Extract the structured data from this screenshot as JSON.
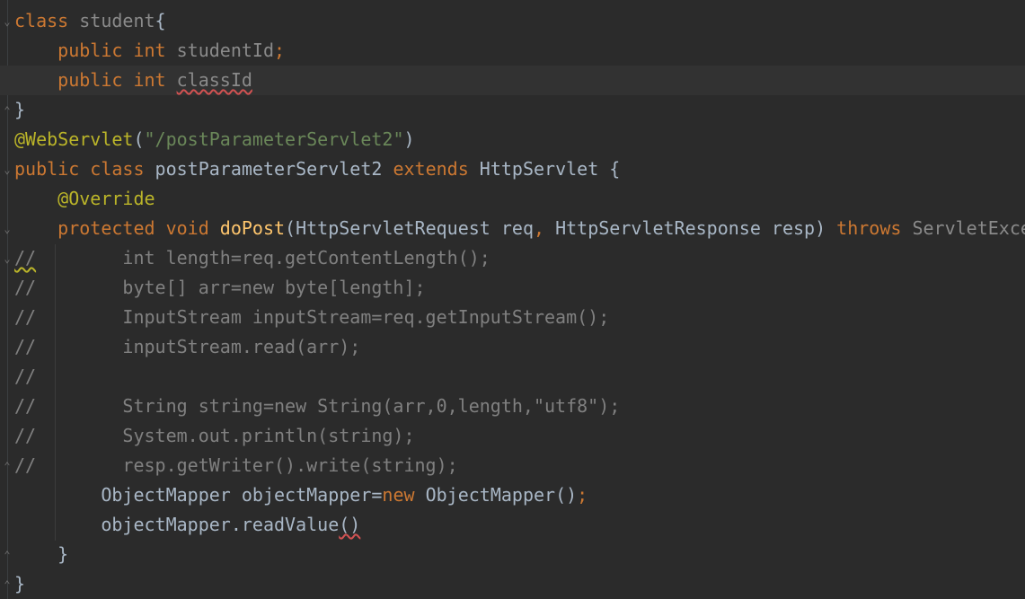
{
  "lines": [
    {
      "indent": "",
      "parts": [
        [
          "kw",
          "class "
        ],
        [
          "gray",
          "student"
        ],
        [
          "plain",
          "{"
        ]
      ],
      "fold": "▽"
    },
    {
      "indent": "    ",
      "parts": [
        [
          "kw",
          "public int "
        ],
        [
          "gray",
          "studentId"
        ],
        [
          "kw",
          ";"
        ]
      ]
    },
    {
      "indent": "    ",
      "parts": [
        [
          "kw",
          "public int "
        ],
        [
          "gray",
          "classId"
        ]
      ],
      "current": true,
      "error": "classId"
    },
    {
      "indent": "",
      "parts": [
        [
          "plain",
          "}"
        ]
      ],
      "fold": "△"
    },
    {
      "indent": "",
      "parts": [
        [
          "ann",
          "@WebServlet"
        ],
        [
          "plain",
          "("
        ],
        [
          "str",
          "\"/postParameterServlet2\""
        ],
        [
          "plain",
          ")"
        ]
      ]
    },
    {
      "indent": "",
      "parts": [
        [
          "kw",
          "public class "
        ],
        [
          "plain",
          "postParameterServlet2 "
        ],
        [
          "kw",
          "extends "
        ],
        [
          "plain",
          "HttpServlet {"
        ]
      ],
      "fold": "▽"
    },
    {
      "indent": "    ",
      "parts": [
        [
          "ann",
          "@Override"
        ]
      ]
    },
    {
      "indent": "    ",
      "parts": [
        [
          "kw",
          "protected void "
        ],
        [
          "fn",
          "doPost"
        ],
        [
          "plain",
          "(HttpServletRequest req"
        ],
        [
          "kw",
          ", "
        ],
        [
          "plain",
          "HttpServletResponse resp) "
        ],
        [
          "kw",
          "throws "
        ],
        [
          "gray",
          "ServletExce"
        ]
      ],
      "fold": "▽"
    },
    {
      "indent": "",
      "parts": [
        [
          "cm",
          "//        int length=req.getContentLength();"
        ]
      ],
      "fold": "▽",
      "warn": "//"
    },
    {
      "indent": "",
      "parts": [
        [
          "cm",
          "//        byte[] arr=new byte[length];"
        ]
      ]
    },
    {
      "indent": "",
      "parts": [
        [
          "cm",
          "//        InputStream inputStream=req.getInputStream();"
        ]
      ]
    },
    {
      "indent": "",
      "parts": [
        [
          "cm",
          "//        inputStream.read(arr);"
        ]
      ]
    },
    {
      "indent": "",
      "parts": [
        [
          "cm",
          "//"
        ]
      ]
    },
    {
      "indent": "",
      "parts": [
        [
          "cm",
          "//        String string=new String(arr,0,length,\"utf8\");"
        ]
      ]
    },
    {
      "indent": "",
      "parts": [
        [
          "cm",
          "//        System.out.println(string);"
        ]
      ]
    },
    {
      "indent": "",
      "parts": [
        [
          "cm",
          "//        resp.getWriter().write(string);"
        ]
      ],
      "fold": "△"
    },
    {
      "indent": "        ",
      "parts": [
        [
          "plain",
          "ObjectMapper objectMapper="
        ],
        [
          "kw",
          "new "
        ],
        [
          "plain",
          "ObjectMapper()"
        ],
        [
          "kw",
          ";"
        ]
      ]
    },
    {
      "indent": "        ",
      "parts": [
        [
          "plain",
          "objectMapper.readValue"
        ],
        [
          "plain",
          "()"
        ]
      ],
      "error": "()"
    },
    {
      "indent": "    ",
      "parts": [
        [
          "plain",
          "}"
        ]
      ],
      "fold": "△"
    },
    {
      "indent": "",
      "parts": [
        [
          "plain",
          "}"
        ]
      ],
      "fold": "△"
    }
  ]
}
